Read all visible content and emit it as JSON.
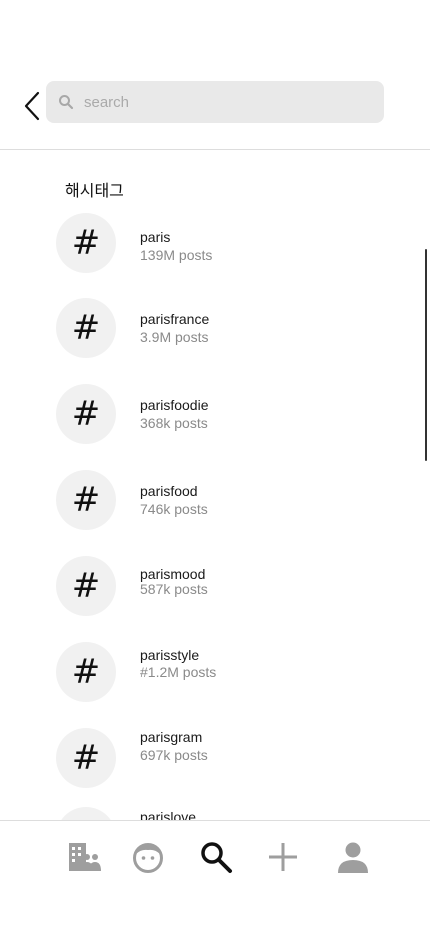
{
  "search": {
    "placeholder": "search",
    "value": ""
  },
  "section": {
    "title": "해시태그"
  },
  "results": [
    {
      "symbol": "#",
      "name": "paris",
      "count": "139M posts"
    },
    {
      "symbol": "#",
      "name": "parisfrance",
      "count": "3.9M posts"
    },
    {
      "symbol": "#",
      "name": "parisfoodie",
      "count": "368k posts"
    },
    {
      "symbol": "#",
      "name": "parisfood",
      "count": "746k posts"
    },
    {
      "symbol": "#",
      "name": "parismood",
      "count": "587k posts"
    },
    {
      "symbol": "#",
      "name": "parisstyle",
      "count": "#1.2M posts"
    },
    {
      "symbol": "#",
      "name": "parisgram",
      "count": "697k posts"
    },
    {
      "symbol": "#",
      "name": "parislove",
      "count": ""
    }
  ],
  "tabs": [
    {
      "icon": "building-people-icon"
    },
    {
      "icon": "face-icon"
    },
    {
      "icon": "search-icon",
      "active": true
    },
    {
      "icon": "plus-icon"
    },
    {
      "icon": "person-icon"
    }
  ],
  "colors": {
    "search_bg": "#e9e9e9",
    "circle_bg": "#f1f1f1",
    "muted_text": "#8a8a8a",
    "icon_gray": "#9e9e9e",
    "active_icon": "#111111"
  }
}
